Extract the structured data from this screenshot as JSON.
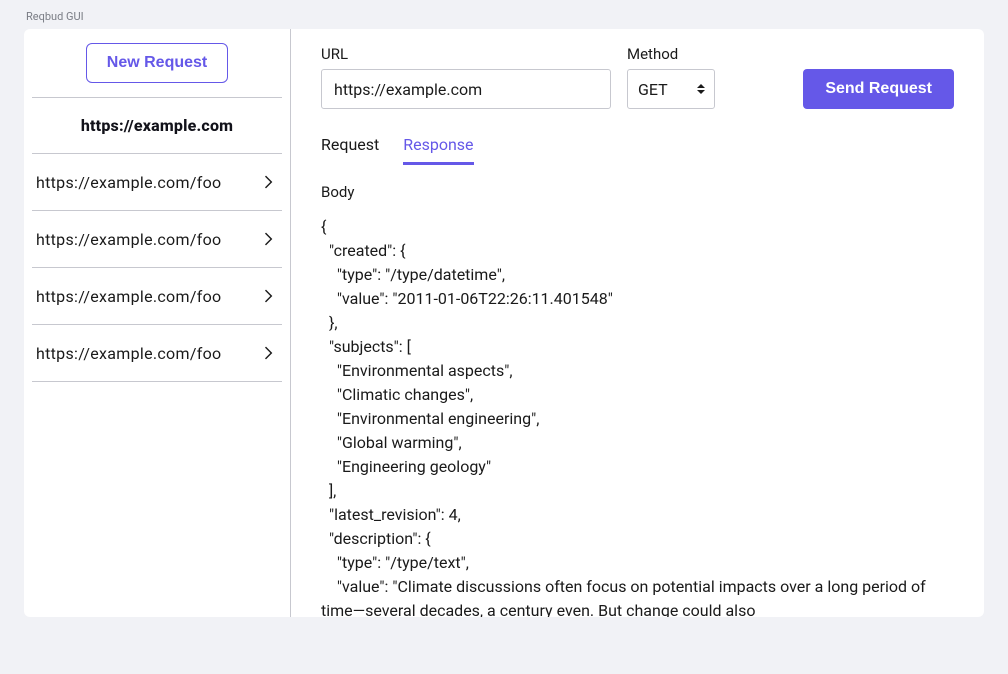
{
  "app_label": "Reqbud GUI",
  "sidebar": {
    "new_request_label": "New Request",
    "active_request": "https://example.com",
    "items": [
      {
        "label": "https://example.com/foo"
      },
      {
        "label": "https://example.com/foo"
      },
      {
        "label": "https://example.com/foo"
      },
      {
        "label": "https://example.com/foo"
      }
    ]
  },
  "top": {
    "url_label": "URL",
    "url_value": "https://example.com",
    "method_label": "Method",
    "method_value": "GET",
    "send_label": "Send Request"
  },
  "tabs": {
    "request": "Request",
    "response": "Response",
    "active": "response"
  },
  "body": {
    "label": "Body",
    "content": "{\n  \"created\": {\n    \"type\": \"/type/datetime\",\n    \"value\": \"2011-01-06T22:26:11.401548\"\n  },\n  \"subjects\": [\n    \"Environmental aspects\",\n    \"Climatic changes\",\n    \"Environmental engineering\",\n    \"Global warming\",\n    \"Engineering geology\"\n  ],\n  \"latest_revision\": 4,\n  \"description\": {\n    \"type\": \"/type/text\",\n    \"value\": \"Climate discussions often focus on potential impacts over a long period of time—several decades, a century even. But change could also"
  }
}
